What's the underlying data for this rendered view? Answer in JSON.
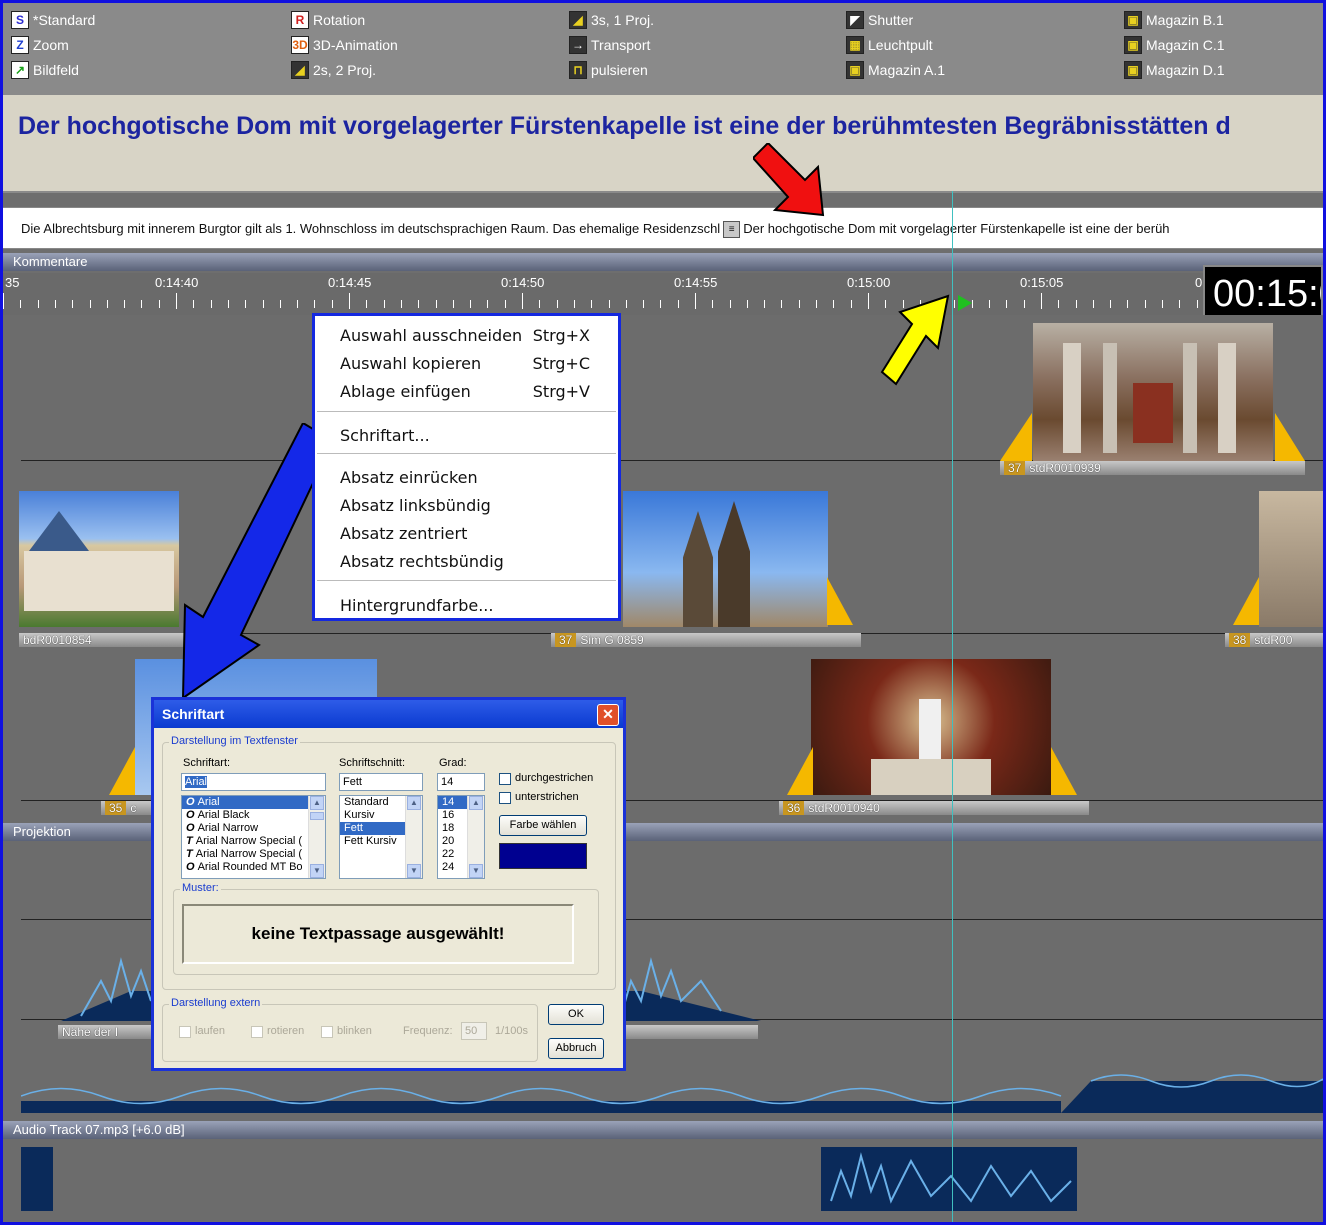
{
  "effects": [
    [
      {
        "icon": "standard-icon",
        "glyph": "S",
        "color": "#2a2ad0",
        "label": "*Standard"
      },
      {
        "icon": "zoom-icon",
        "glyph": "Z",
        "color": "#2040d0",
        "label": "Zoom"
      },
      {
        "icon": "bildfeld-icon",
        "glyph": "↗",
        "color": "#18a018",
        "label": "Bildfeld"
      }
    ],
    [
      {
        "icon": "rotation-icon",
        "glyph": "R",
        "color": "#d02020",
        "label": "Rotation"
      },
      {
        "icon": "3d-animation-icon",
        "glyph": "3D",
        "color": "#e06010",
        "label": "3D-Animation"
      },
      {
        "icon": "2s-2proj-icon",
        "glyph": "◢",
        "color": "#e8d020",
        "label": "2s, 2 Proj."
      }
    ],
    [
      {
        "icon": "3s-1proj-icon",
        "glyph": "◢",
        "color": "#e8d020",
        "label": "3s, 1 Proj."
      },
      {
        "icon": "transport-icon",
        "glyph": "→",
        "color": "#ffffff",
        "label": "Transport"
      },
      {
        "icon": "pulsieren-icon",
        "glyph": "⊓",
        "color": "#e8d020",
        "label": "pulsieren"
      }
    ],
    [
      {
        "icon": "shutter-icon",
        "glyph": "◤",
        "color": "#ffffff",
        "label": "Shutter"
      },
      {
        "icon": "leuchtpult-icon",
        "glyph": "▦",
        "color": "#e8d020",
        "label": "Leuchtpult"
      },
      {
        "icon": "magazin-icon",
        "glyph": "▣",
        "color": "#e8d020",
        "label": "Magazin A.1"
      }
    ],
    [
      {
        "icon": "magazin-icon",
        "glyph": "▣",
        "color": "#e8d020",
        "label": "Magazin B.1"
      },
      {
        "icon": "magazin-icon",
        "glyph": "▣",
        "color": "#e8d020",
        "label": "Magazin C.1"
      },
      {
        "icon": "magazin-icon",
        "glyph": "▣",
        "color": "#e8d020",
        "label": "Magazin D.1"
      }
    ]
  ],
  "title_text": "Der hochgotische Dom mit vorgelagerter Fürstenkapelle ist eine der berühmtesten Begräbnisstätten d",
  "text_track": {
    "part1": "Die Albrechtsburg mit innerem Burgtor gilt als 1. Wohnschloss im deutschsprachigen Raum. Das ehemalige Residenzschl",
    "part2": "Der hochgotische Dom mit vorgelagerter Fürstenkapelle ist eine der berüh"
  },
  "sections": {
    "comments": "Kommentare",
    "projection": "Projektion",
    "audio": "Audio Track 07.mp3 [+6.0 dB]"
  },
  "ruler": {
    "labels": [
      "35",
      "0:14:40",
      "0:14:45",
      "0:14:50",
      "0:14:55",
      "0:15:00",
      "0:15:05",
      "0"
    ]
  },
  "timecode": "00:15:0",
  "clips": [
    {
      "num": "",
      "name": "bdR0010854"
    },
    {
      "num": "37",
      "name": "stdR0010939"
    },
    {
      "num": "37",
      "name": "Sim G 0859"
    },
    {
      "num": "38",
      "name": "stdR00"
    },
    {
      "num": "35",
      "name": "c"
    },
    {
      "num": "36",
      "name": "stdR0010940"
    },
    {
      "num": "",
      "name": "Nähe der I"
    }
  ],
  "context_menu": {
    "items": [
      {
        "label": "Auswahl ausschneiden",
        "shortcut": "Strg+X"
      },
      {
        "label": "Auswahl kopieren",
        "shortcut": "Strg+C"
      },
      {
        "label": "Ablage einfügen",
        "shortcut": "Strg+V"
      },
      {
        "label": "Schriftart...",
        "shortcut": ""
      },
      {
        "label": "Absatz einrücken",
        "shortcut": ""
      },
      {
        "label": "Absatz linksbündig",
        "shortcut": ""
      },
      {
        "label": "Absatz zentriert",
        "shortcut": ""
      },
      {
        "label": "Absatz rechtsbündig",
        "shortcut": ""
      },
      {
        "label": "Hintergrundfarbe...",
        "shortcut": ""
      }
    ]
  },
  "font_dialog": {
    "title": "Schriftart",
    "group_internal": "Darstellung im Textfenster",
    "font_label": "Schriftart:",
    "font_value": "Arial",
    "fonts": [
      "Arial",
      "Arial Black",
      "Arial Narrow",
      "Arial Narrow Special (",
      "Arial Narrow Special (",
      "Arial Rounded MT Bo"
    ],
    "style_label": "Schriftschnitt:",
    "style_value": "Fett",
    "styles": [
      "Standard",
      "Kursiv",
      "Fett",
      "Fett Kursiv"
    ],
    "size_label": "Grad:",
    "size_value": "14",
    "sizes": [
      "14",
      "16",
      "18",
      "20",
      "22",
      "24"
    ],
    "strike_label": "durchgestrichen",
    "underline_label": "unterstrichen",
    "color_button": "Farbe wählen",
    "swatch_color": "#000090",
    "sample_label": "Muster:",
    "sample_text": "keine Textpassage ausgewählt!",
    "group_external": "Darstellung extern",
    "opt_run": "laufen",
    "opt_rotate": "rotieren",
    "opt_blink": "blinken",
    "freq_label": "Frequenz:",
    "freq_value": "50",
    "freq_unit": "1/100s",
    "ok": "OK",
    "cancel": "Abbruch"
  }
}
